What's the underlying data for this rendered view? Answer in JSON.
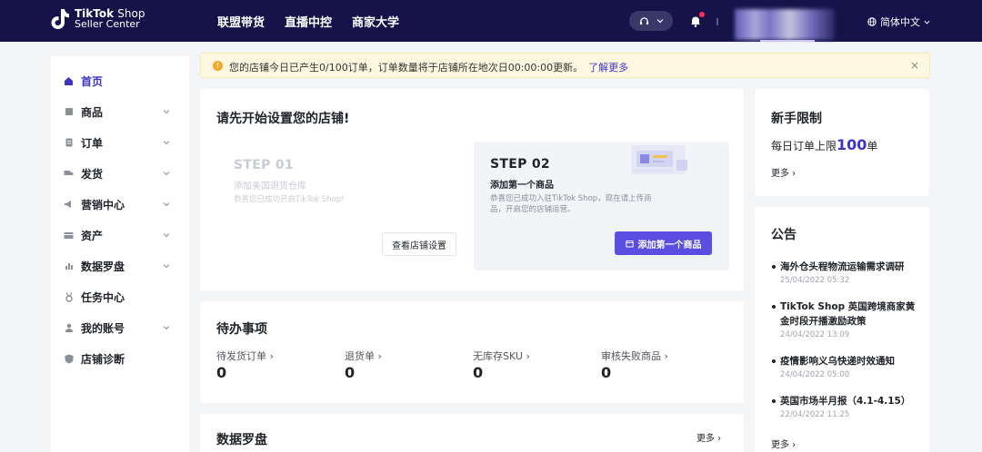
{
  "topbar": {
    "logo_line1_bold": "TikTok",
    "logo_line1_thin": "Shop",
    "logo_line2": "Seller Center",
    "nav": [
      "联盟带货",
      "直播中控",
      "商家大学"
    ],
    "language": "简体中文",
    "icons": [
      "headset-icon",
      "chevron-down-icon",
      "bell-icon",
      "globe-icon"
    ],
    "brand_color": "#15134a",
    "notification_dot_color": "#fe2c55"
  },
  "sidebar": {
    "items": [
      {
        "label": "首页",
        "icon": "home-icon",
        "expandable": false
      },
      {
        "label": "商品",
        "icon": "product-icon",
        "expandable": true
      },
      {
        "label": "订单",
        "icon": "order-icon",
        "expandable": true
      },
      {
        "label": "发货",
        "icon": "shipping-icon",
        "expandable": true
      },
      {
        "label": "营销中心",
        "icon": "megaphone-icon",
        "expandable": true
      },
      {
        "label": "资产",
        "icon": "wallet-icon",
        "expandable": true
      },
      {
        "label": "数据罗盘",
        "icon": "bar-chart-icon",
        "expandable": true
      },
      {
        "label": "任务中心",
        "icon": "medal-icon",
        "expandable": false
      },
      {
        "label": "我的账号",
        "icon": "user-icon",
        "expandable": true
      },
      {
        "label": "店铺诊断",
        "icon": "shield-icon",
        "expandable": false
      }
    ],
    "active_index": 0,
    "accent_color": "#3b34c4"
  },
  "notice": {
    "message": "您的店铺今日已产生0/100订单，订单数量将于店铺所在地次日00:00:00更新。",
    "link": "了解更多",
    "close": "×"
  },
  "setup": {
    "title": "请先开始设置您的店铺!",
    "step1": {
      "heading": "STEP 01",
      "title": "添加美国退货仓库",
      "desc": "恭喜您已成功开启TikTok Shop!",
      "button": "查看店铺设置"
    },
    "step2": {
      "heading": "STEP 02",
      "title": "添加第一个商品",
      "desc": "恭喜您已成功入驻TikTok Shop，现在请上传商品，开启您的店铺运营。",
      "button": "添加第一个商品"
    }
  },
  "todo": {
    "title": "待办事项",
    "items": [
      {
        "label": "待发货订单",
        "value": "0"
      },
      {
        "label": "退货单",
        "value": "0"
      },
      {
        "label": "无库存SKU",
        "value": "0"
      },
      {
        "label": "审核失败商品",
        "value": "0"
      }
    ]
  },
  "data_compass": {
    "title": "数据罗盘",
    "more": "更多"
  },
  "limit": {
    "title": "新手限制",
    "text_prefix": "每日订单上限",
    "value": "100",
    "text_suffix": "单",
    "more": "更多"
  },
  "announcement": {
    "title": "公告",
    "items": [
      {
        "title": "海外仓头程物流运输需求调研",
        "date": "25/04/2022 05:32"
      },
      {
        "title": "TikTok Shop 英国跨境商家黄金时段开播激励政策",
        "date": "24/04/2022 13:09"
      },
      {
        "title": "疫情影响义乌快递时效通知",
        "date": "24/04/2022 05:00"
      },
      {
        "title": "英国市场半月报（4.1-4.15）",
        "date": "22/04/2022 11:25"
      }
    ],
    "more": "更多"
  }
}
